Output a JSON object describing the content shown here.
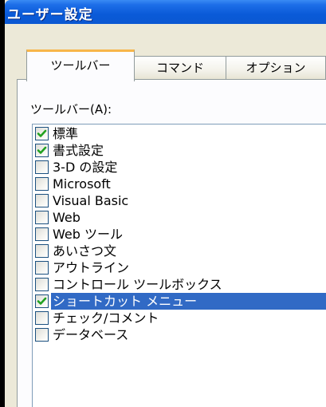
{
  "window": {
    "title": "ユーザー設定"
  },
  "tabs": [
    {
      "label": "ツールバー",
      "active": true
    },
    {
      "label": "コマンド",
      "active": false
    },
    {
      "label": "オプション",
      "active": false
    }
  ],
  "toolbars_list": {
    "label": "ツールバー(A):",
    "items": [
      {
        "label": "標準",
        "checked": true,
        "selected": false
      },
      {
        "label": "書式設定",
        "checked": true,
        "selected": false
      },
      {
        "label": "3-D の設定",
        "checked": false,
        "selected": false
      },
      {
        "label": "Microsoft",
        "checked": false,
        "selected": false
      },
      {
        "label": "Visual Basic",
        "checked": false,
        "selected": false
      },
      {
        "label": "Web",
        "checked": false,
        "selected": false
      },
      {
        "label": "Web ツール",
        "checked": false,
        "selected": false
      },
      {
        "label": "あいさつ文",
        "checked": false,
        "selected": false
      },
      {
        "label": "アウトライン",
        "checked": false,
        "selected": false
      },
      {
        "label": "コントロール ツールボックス",
        "checked": false,
        "selected": false
      },
      {
        "label": "ショートカット メニュー",
        "checked": true,
        "selected": true
      },
      {
        "label": "チェック/コメント",
        "checked": false,
        "selected": false
      },
      {
        "label": "データベース",
        "checked": false,
        "selected": false
      }
    ]
  },
  "colors": {
    "titlebar": "#0a5ad8",
    "selection": "#316ac5",
    "checkmark": "#21a121",
    "tab_highlight": "#f7b64a"
  }
}
